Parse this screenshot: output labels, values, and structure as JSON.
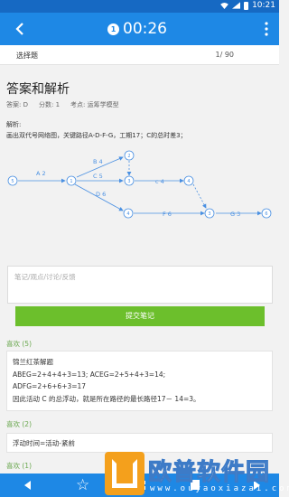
{
  "status_bar": {
    "time": "10:21"
  },
  "app_bar": {
    "timer_icon_text": "1",
    "timer": "00:26"
  },
  "question_header": {
    "type_label": "选择题",
    "progress": "1/ 90"
  },
  "answer_section": {
    "title": "答案和解析",
    "answer": "答案: D",
    "score": "分数: 1",
    "topic": "考点: 运筹学模型",
    "analysis_label": "解析:",
    "analysis_text": "画出双代号网络图，关键路径A-D-F-G，工期17；C的总时差3；"
  },
  "diagram": {
    "nodes": [
      "5",
      "1",
      "2",
      "3",
      "4",
      "4",
      "3",
      "6"
    ],
    "edges": [
      "A 2",
      "B 4",
      "C 5",
      "c 4",
      "D 6",
      "F 6",
      "G 3"
    ]
  },
  "notes": {
    "placeholder": "笔记/观点/讨论/反馈",
    "submit_label": "提交笔记"
  },
  "comments": [
    {
      "likes": "喜欢 (5)",
      "lines": [
        "锦兰红茶解题",
        "ABEG=2+4+4+3=13; ACEG=2+5+4+3=14;",
        "ADFG=2+6+6+3=17",
        "因此活动 C 的总浮动，就是所在路径的最长路径17－ 14=3。"
      ]
    },
    {
      "likes": "喜欢 (2)",
      "lines": [
        "浮动时间=活动-紧前"
      ]
    },
    {
      "likes": "喜欢 (1)",
      "lines": []
    }
  ],
  "watermark": {
    "brand": "欧普软件园",
    "url": "www.ouyaoxiazai.com"
  },
  "colors": {
    "primary": "#1e88e5",
    "accent_green": "#6cbf2c",
    "likes_green": "#6aa84f",
    "logo_orange": "#f4a01c"
  },
  "icons": [
    "back-arrow-icon",
    "timer-icon",
    "more-vert-icon",
    "star-icon",
    "grid-icon",
    "home-icon",
    "nav-back-icon",
    "nav-forward-icon"
  ]
}
